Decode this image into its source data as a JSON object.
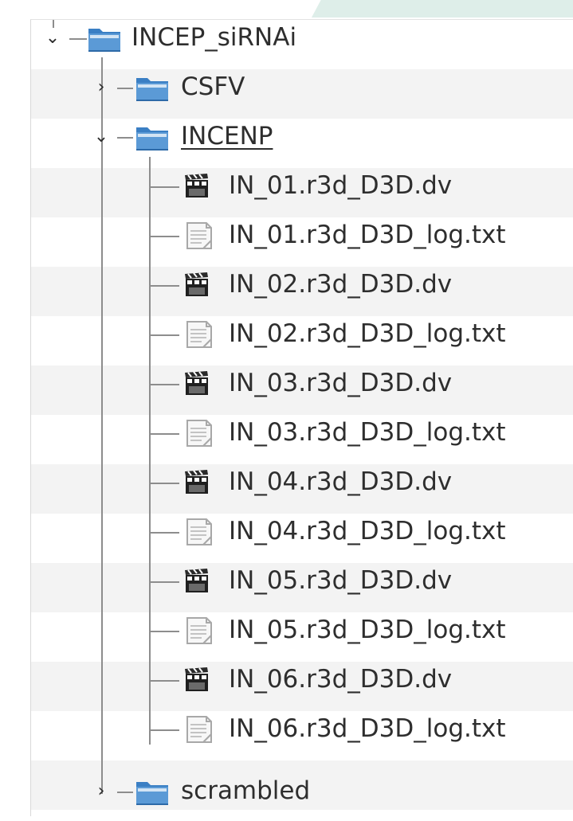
{
  "tree": {
    "root": {
      "label": "INCEP_siRNAi",
      "expanded": true,
      "icon": "folder-icon"
    },
    "folders": [
      {
        "label": "CSFV",
        "expanded": false,
        "icon": "folder-icon"
      },
      {
        "label": "INCENP",
        "expanded": true,
        "selected": true,
        "icon": "folder-icon"
      },
      {
        "label": "scrambled",
        "expanded": false,
        "icon": "folder-icon"
      }
    ],
    "files": [
      {
        "label": "IN_01.r3d_D3D.dv",
        "icon": "film-clapper-icon"
      },
      {
        "label": "IN_01.r3d_D3D_log.txt",
        "icon": "text-file-icon"
      },
      {
        "label": "IN_02.r3d_D3D.dv",
        "icon": "film-clapper-icon"
      },
      {
        "label": "IN_02.r3d_D3D_log.txt",
        "icon": "text-file-icon"
      },
      {
        "label": "IN_03.r3d_D3D.dv",
        "icon": "film-clapper-icon"
      },
      {
        "label": "IN_03.r3d_D3D_log.txt",
        "icon": "text-file-icon"
      },
      {
        "label": "IN_04.r3d_D3D.dv",
        "icon": "film-clapper-icon"
      },
      {
        "label": "IN_04.r3d_D3D_log.txt",
        "icon": "text-file-icon"
      },
      {
        "label": "IN_05.r3d_D3D.dv",
        "icon": "film-clapper-icon"
      },
      {
        "label": "IN_05.r3d_D3D_log.txt",
        "icon": "text-file-icon"
      },
      {
        "label": "IN_06.r3d_D3D.dv",
        "icon": "film-clapper-icon"
      },
      {
        "label": "IN_06.r3d_D3D_log.txt",
        "icon": "text-file-icon"
      }
    ],
    "colors": {
      "folder": "#3a7fc4",
      "folder_light": "#d2e4f4",
      "stripe": "#f3f3f3",
      "connector": "#8d8d8d",
      "text": "#2e2e2e"
    }
  }
}
